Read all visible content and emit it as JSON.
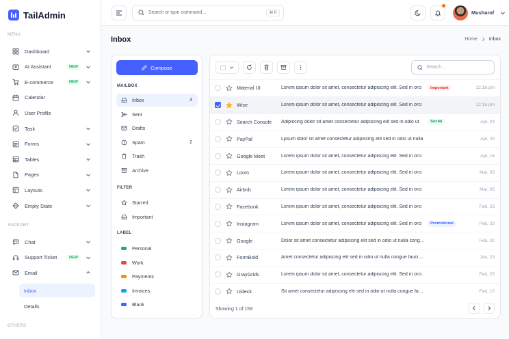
{
  "app": {
    "name": "TailAdmin"
  },
  "sidebar": {
    "menu_title": "MENU",
    "items": [
      {
        "label": "Dashboard",
        "icon": "grid-icon",
        "badge": "",
        "chevron": "down"
      },
      {
        "label": "AI Assistant",
        "icon": "sparkle-icon",
        "badge": "NEW",
        "chevron": "down"
      },
      {
        "label": "E-commerce",
        "icon": "cart-icon",
        "badge": "NEW",
        "chevron": "down"
      },
      {
        "label": "Calendar",
        "icon": "calendar-icon",
        "badge": "",
        "chevron": ""
      },
      {
        "label": "User Profile",
        "icon": "user-icon",
        "badge": "",
        "chevron": ""
      },
      {
        "label": "Task",
        "icon": "task-icon",
        "badge": "",
        "chevron": "down"
      },
      {
        "label": "Forms",
        "icon": "form-icon",
        "badge": "",
        "chevron": "down"
      },
      {
        "label": "Tables",
        "icon": "table-icon",
        "badge": "",
        "chevron": "down"
      },
      {
        "label": "Pages",
        "icon": "page-icon",
        "badge": "",
        "chevron": "down"
      },
      {
        "label": "Layouts",
        "icon": "layout-icon",
        "badge": "",
        "chevron": "down"
      },
      {
        "label": "Empty State",
        "icon": "empty-icon",
        "badge": "",
        "chevron": "down"
      }
    ],
    "support_title": "SUPPORT",
    "support_items": [
      {
        "label": "Chat",
        "icon": "chat-icon",
        "badge": "",
        "chevron": "down"
      },
      {
        "label": "Support Ticket",
        "icon": "headset-icon",
        "badge": "NEW",
        "chevron": "down"
      },
      {
        "label": "Email",
        "icon": "mail-icon",
        "badge": "",
        "chevron": "up"
      }
    ],
    "email_sub": [
      "Inbox",
      "Details"
    ],
    "others_title": "OTHERS"
  },
  "header": {
    "search_placeholder": "Search or type command...",
    "shortcut": "⌘ K",
    "user_name": "Musharof"
  },
  "page": {
    "title": "Inbox",
    "breadcrumb_home": "Home",
    "breadcrumb_current": "Inbox"
  },
  "mailbox": {
    "compose_label": "Compose",
    "mailbox_title": "MAILBOX",
    "folders": [
      {
        "label": "Inbox",
        "icon": "inbox-icon",
        "count": "3"
      },
      {
        "label": "Sent",
        "icon": "send-icon",
        "count": ""
      },
      {
        "label": "Drafts",
        "icon": "draft-icon",
        "count": ""
      },
      {
        "label": "Spam",
        "icon": "spam-icon",
        "count": "2"
      },
      {
        "label": "Trash",
        "icon": "trash-icon",
        "count": ""
      },
      {
        "label": "Archive",
        "icon": "archive-icon",
        "count": ""
      }
    ],
    "filter_title": "FILTER",
    "filters": [
      {
        "label": "Starred",
        "icon": "star-icon"
      },
      {
        "label": "Important",
        "icon": "important-icon"
      }
    ],
    "label_title": "LABEL",
    "labels": [
      {
        "label": "Personal",
        "color": "#12b76a"
      },
      {
        "label": "Work",
        "color": "#f04438"
      },
      {
        "label": "Payments",
        "color": "#f79009"
      },
      {
        "label": "Invoices",
        "color": "#0ba5ec"
      },
      {
        "label": "Blank",
        "color": "#465fff"
      }
    ]
  },
  "list": {
    "search_placeholder": "Search...",
    "footer": "Showing 1 of 159",
    "emails": [
      {
        "sender": "Material UI",
        "subject": "Lorem ipsum dolor sit amet, consectetur adipiscing elit. Sed in orci",
        "tag": "Important",
        "tag_bg": "#fef3f2",
        "tag_fg": "#d92d20",
        "date": "12:16 pm",
        "starred": false,
        "selected": false
      },
      {
        "sender": "Wise",
        "subject": "Lorem ipsum dolor sit amet, consectetur adipiscing elit. Sed in orci",
        "tag": "",
        "tag_bg": "",
        "tag_fg": "",
        "date": "12:16 pm",
        "starred": true,
        "selected": true
      },
      {
        "sender": "Search Console",
        "subject": "Adipiscing dolor sit amet consectetur adipiscing elit sed in odio ut",
        "tag": "Social",
        "tag_bg": "#ecfdf3",
        "tag_fg": "#039855",
        "date": "Apr, 24",
        "starred": false,
        "selected": false
      },
      {
        "sender": "PayPal",
        "subject": "Lpsum dolor sit amet consectetur adipiscing elit sed in odio ut nulla",
        "tag": "",
        "tag_bg": "",
        "tag_fg": "",
        "date": "Apr, 20",
        "starred": false,
        "selected": false
      },
      {
        "sender": "Google Meet",
        "subject": "Lorem ipsum dolor sit amet, consectetur adipiscing elit. Sed in orci",
        "tag": "",
        "tag_bg": "",
        "tag_fg": "",
        "date": "Apr, 16",
        "starred": false,
        "selected": false
      },
      {
        "sender": "Loom",
        "subject": "Lorem ipsum dolor sit amet, consectetur adipiscing elit. Sed in orci",
        "tag": "",
        "tag_bg": "",
        "tag_fg": "",
        "date": "Mar, 05",
        "starred": false,
        "selected": false
      },
      {
        "sender": "Airbnb",
        "subject": "Lorem ipsum dolor sit amet, consectetur adipiscing elit. Sed in orci",
        "tag": "",
        "tag_bg": "",
        "tag_fg": "",
        "date": "Mar, 05",
        "starred": false,
        "selected": false
      },
      {
        "sender": "Facebook",
        "subject": "Lorem ipsum dolor sit amet, consectetur adipiscing elit. Sed in orci",
        "tag": "",
        "tag_bg": "",
        "tag_fg": "",
        "date": "Feb, 25",
        "starred": false,
        "selected": false
      },
      {
        "sender": "Instagram",
        "subject": "Lorem ipsum dolor sit amet, consectetur adipiscing elit. Sed in orci",
        "tag": "Promotional",
        "tag_bg": "#ecf3ff",
        "tag_fg": "#465fff",
        "date": "Feb, 20",
        "starred": false,
        "selected": false
      },
      {
        "sender": "Google",
        "subject": "Dolor sit amet consectetur adipiscing elit sed in odio ut nulla congue",
        "tag": "",
        "tag_bg": "",
        "tag_fg": "",
        "date": "Feb, 02",
        "starred": false,
        "selected": false
      },
      {
        "sender": "FormBold",
        "subject": "Amet consectetur adipiscing elit sed in odio ut nulla congue faucibus",
        "tag": "",
        "tag_bg": "",
        "tag_fg": "",
        "date": "Jan, 23",
        "starred": false,
        "selected": false
      },
      {
        "sender": "GrayGrids",
        "subject": "Lorem ipsum dolor sit amet, consectetur adipiscing elit. Sed in orci",
        "tag": "",
        "tag_bg": "",
        "tag_fg": "",
        "date": "Feb, 25",
        "starred": false,
        "selected": false
      },
      {
        "sender": "Uideck",
        "subject": "Sit amet consectetur adipiscing elit sed in odio ut nulla congue faucibus",
        "tag": "",
        "tag_bg": "",
        "tag_fg": "",
        "date": "Feb, 15",
        "starred": false,
        "selected": false
      }
    ]
  },
  "colors": {
    "brand": "#465fff",
    "success": "#12b76a"
  }
}
